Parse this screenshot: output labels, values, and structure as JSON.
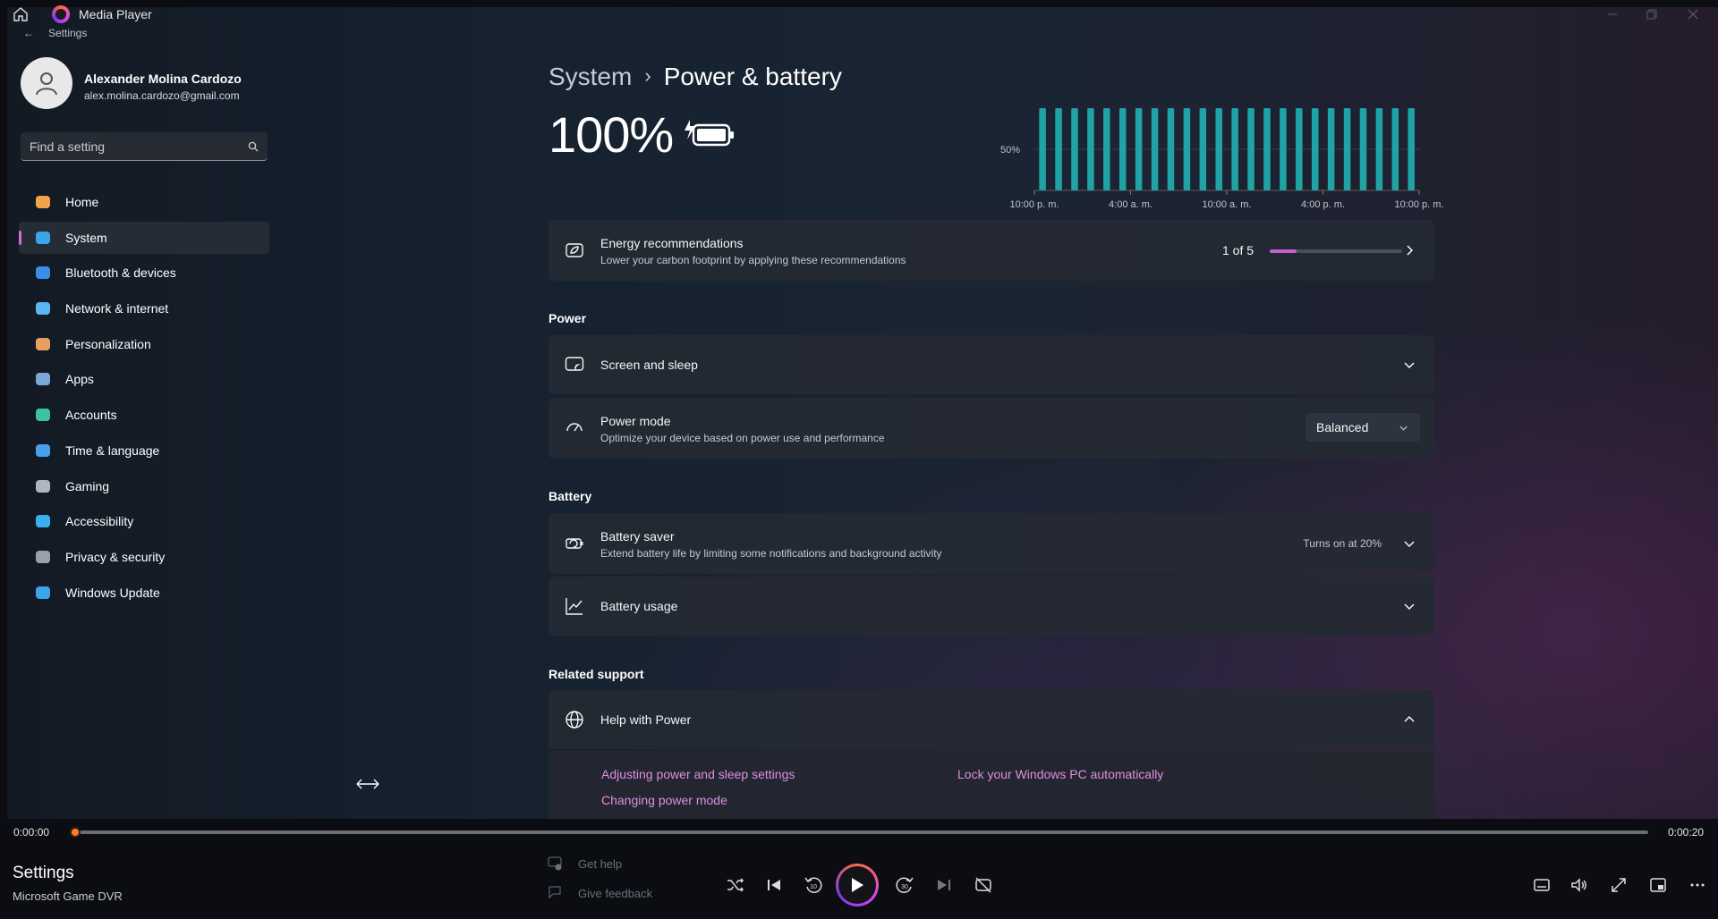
{
  "player": {
    "app_title": "Media Player",
    "time_current": "0:00:00",
    "time_total": "0:00:20",
    "progress_fraction": 0.0,
    "now_playing_title": "Settings",
    "now_playing_subtitle": "Microsoft Game DVR"
  },
  "settings": {
    "back_label": "Settings",
    "user": {
      "name": "Alexander Molina Cardozo",
      "email": "alex.molina.cardozo@gmail.com"
    },
    "search": {
      "placeholder": "Find a setting"
    },
    "nav": [
      {
        "label": "Home",
        "icon": "home-icon",
        "active": false
      },
      {
        "label": "System",
        "icon": "system-icon",
        "active": true
      },
      {
        "label": "Bluetooth & devices",
        "icon": "bluetooth-icon",
        "active": false
      },
      {
        "label": "Network & internet",
        "icon": "wifi-icon",
        "active": false
      },
      {
        "label": "Personalization",
        "icon": "brush-icon",
        "active": false
      },
      {
        "label": "Apps",
        "icon": "apps-icon",
        "active": false
      },
      {
        "label": "Accounts",
        "icon": "accounts-icon",
        "active": false
      },
      {
        "label": "Time & language",
        "icon": "globe-clock-icon",
        "active": false
      },
      {
        "label": "Gaming",
        "icon": "gamepad-icon",
        "active": false
      },
      {
        "label": "Accessibility",
        "icon": "accessibility-icon",
        "active": false
      },
      {
        "label": "Privacy & security",
        "icon": "shield-icon",
        "active": false
      },
      {
        "label": "Windows Update",
        "icon": "update-icon",
        "active": false
      }
    ],
    "breadcrumb": {
      "parent": "System",
      "separator": "›",
      "current": "Power & battery"
    },
    "battery_percent": "100%",
    "chart": {
      "y_label": "50%",
      "x_ticks": [
        "10:00 p. m.",
        "4:00 a. m.",
        "10:00 a. m.",
        "4:00 p. m.",
        "10:00 p. m."
      ],
      "bar_count": 24,
      "bar_level_percent": 100,
      "bar_color": "#1fa3a6"
    },
    "energy": {
      "title": "Energy recommendations",
      "subtitle": "Lower your carbon footprint by applying these recommendations",
      "counter": "1 of 5",
      "progress_fraction": 0.2
    },
    "sections": {
      "power": "Power",
      "battery": "Battery",
      "related": "Related support"
    },
    "screen_sleep": {
      "title": "Screen and sleep"
    },
    "power_mode": {
      "title": "Power mode",
      "subtitle": "Optimize your device based on power use and performance",
      "value": "Balanced"
    },
    "battery_saver": {
      "title": "Battery saver",
      "subtitle": "Extend battery life by limiting some notifications and background activity",
      "status": "Turns on at 20%"
    },
    "battery_usage": {
      "title": "Battery usage"
    },
    "help": {
      "title": "Help with Power",
      "links": [
        "Adjusting power and sleep settings",
        "Lock your Windows PC automatically",
        "Changing power mode"
      ]
    },
    "footer": {
      "get_help": "Get help",
      "give_feedback": "Give feedback"
    }
  },
  "colors": {
    "accent": "#d66bd4",
    "link": "#e08ee0",
    "seek_thumb": "#ff7a2f"
  }
}
